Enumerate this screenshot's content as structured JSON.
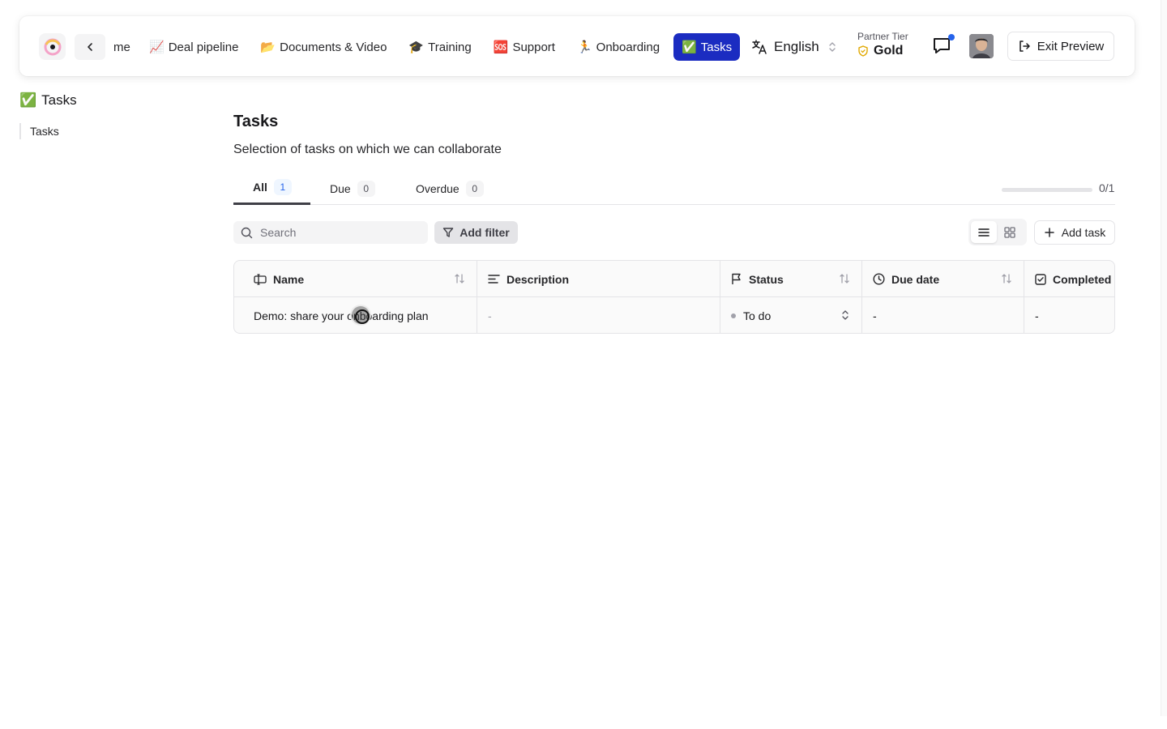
{
  "nav": {
    "clipped_label": "me",
    "items": [
      {
        "emoji": "📈",
        "label": "Deal pipeline"
      },
      {
        "emoji": "📂",
        "label": "Documents & Video"
      },
      {
        "emoji": "🎓",
        "label": "Training"
      },
      {
        "emoji": "🆘",
        "label": "Support"
      },
      {
        "emoji": "🏃",
        "label": "Onboarding"
      },
      {
        "emoji": "✅",
        "label": "Tasks"
      }
    ],
    "language": "English",
    "partner_label": "Partner Tier",
    "partner_tier": "Gold",
    "exit_label": "Exit Preview",
    "accent": "#1b2cc1"
  },
  "sidebar": {
    "title_emoji": "✅",
    "title": "Tasks",
    "items": [
      {
        "label": "Tasks"
      }
    ]
  },
  "main": {
    "title": "Tasks",
    "description": "Selection of tasks on which we can collaborate",
    "tabs": [
      {
        "label": "All",
        "count": "1"
      },
      {
        "label": "Due",
        "count": "0"
      },
      {
        "label": "Overdue",
        "count": "0"
      }
    ],
    "progress": {
      "completed": 0,
      "total": 1,
      "text": "0/1"
    },
    "search_placeholder": "Search",
    "filter_label": "Add filter",
    "add_task_label": "Add task",
    "table": {
      "columns": [
        "Name",
        "Description",
        "Status",
        "Due date",
        "Completed"
      ],
      "rows": [
        {
          "name": "Demo: share your onboarding plan",
          "description": "-",
          "status": "To do",
          "due_date": "-",
          "completed": "-"
        }
      ]
    }
  }
}
